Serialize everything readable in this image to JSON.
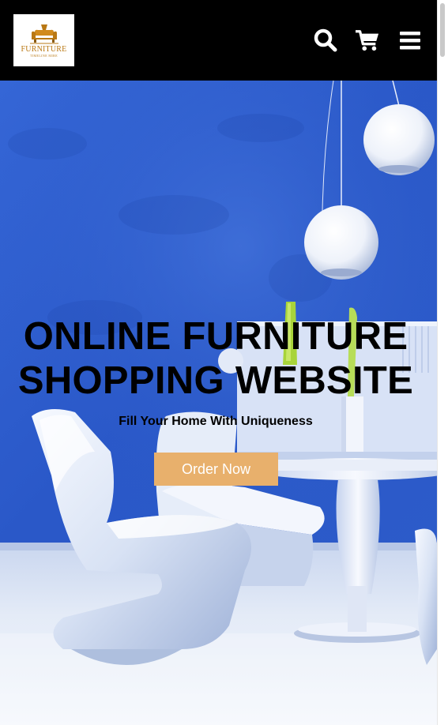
{
  "header": {
    "logo_text": "FURNITURE",
    "logo_sub": "TIMELINE MIRE",
    "icons": [
      "search-icon",
      "cart-icon",
      "menu-icon"
    ]
  },
  "hero": {
    "title_line1": "ONLINE FURNITURE",
    "title_line2": "SHOPPING WEBSITE",
    "subtitle": "Fill Your Home With Uniqueness",
    "cta_label": "Order Now"
  },
  "colors": {
    "header_bg": "#000000",
    "logo_gold": "#b97814",
    "button_bg": "#e8b06c",
    "wall_blue": "#2f5fd0"
  }
}
